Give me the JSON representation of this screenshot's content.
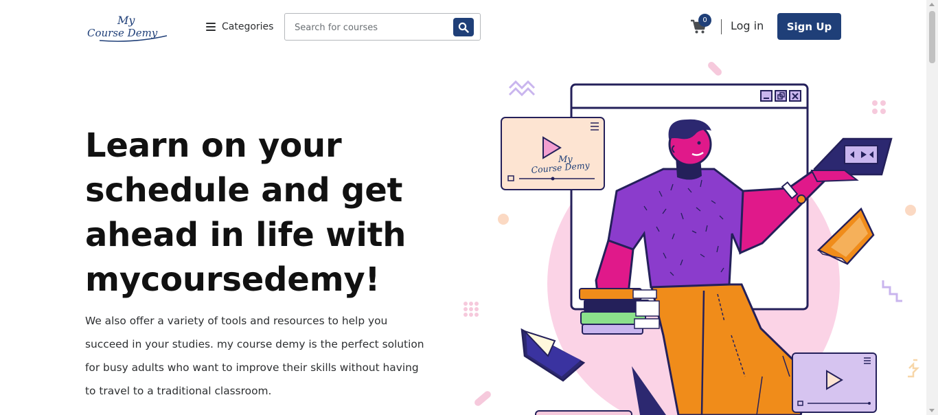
{
  "header": {
    "logo_text_line1": "My",
    "logo_text_line2": "Course Demy",
    "categories_label": "Categories",
    "search_placeholder": "Search for courses",
    "cart_count": "0",
    "login_label": "Log in",
    "signup_label": "Sign Up"
  },
  "hero": {
    "title": "Learn on your schedule and get ahead in life with mycoursedemy!",
    "description": "We also offer a variety of tools and resources to help you succeed in your studies. my course demy is the perfect solution for busy adults who want to improve their skills without having to travel to a traditional classroom."
  },
  "illustration": {
    "video_card_logo_line1": "My",
    "video_card_logo_line2": "Course Demy"
  },
  "colors": {
    "brand": "#1f3f78",
    "pink": "#e0198a",
    "purple": "#8b3ccc",
    "orange": "#f08c1a",
    "blush": "#fbd3e6"
  },
  "icons": [
    "hamburger-icon",
    "search-icon",
    "cart-icon",
    "minimize-icon",
    "restore-icon",
    "close-icon",
    "play-icon",
    "menu-icon"
  ]
}
